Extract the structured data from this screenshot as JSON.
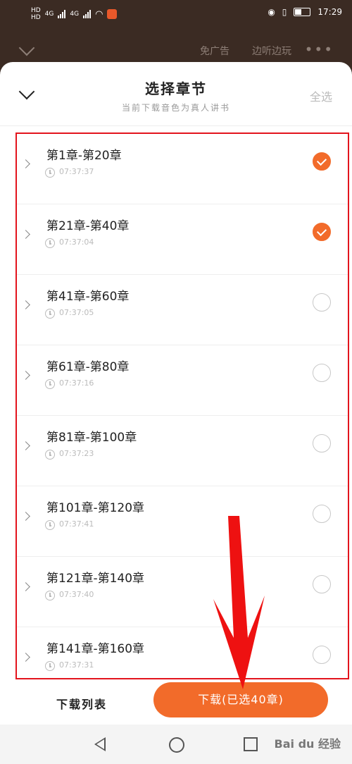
{
  "status_bar": {
    "hd_1": "HD",
    "hd_2": "HD",
    "net_1": "4G",
    "net_2": "4G",
    "battery": "9",
    "time": "17:29"
  },
  "top_bar": {
    "ad_free": "免广告",
    "listen_while": "边听边玩"
  },
  "sheet": {
    "title": "选择章节",
    "subtitle": "当前下载音色为真人讲书",
    "select_all": "全选"
  },
  "chapters": [
    {
      "title": "第1章-第20章",
      "duration": "07:37:37",
      "checked": true
    },
    {
      "title": "第21章-第40章",
      "duration": "07:37:04",
      "checked": true
    },
    {
      "title": "第41章-第60章",
      "duration": "07:37:05",
      "checked": false
    },
    {
      "title": "第61章-第80章",
      "duration": "07:37:16",
      "checked": false
    },
    {
      "title": "第81章-第100章",
      "duration": "07:37:23",
      "checked": false
    },
    {
      "title": "第101章-第120章",
      "duration": "07:37:41",
      "checked": false
    },
    {
      "title": "第121章-第140章",
      "duration": "07:37:40",
      "checked": false
    },
    {
      "title": "第141章-第160章",
      "duration": "07:37:31",
      "checked": false
    }
  ],
  "footer": {
    "download_list": "下载列表",
    "download_button": "下载(已选40章)"
  },
  "watermark": "Bai du 经验",
  "colors": {
    "accent": "#f26b2a",
    "highlight_frame": "#e3141d",
    "arrow": "#ee1111"
  }
}
